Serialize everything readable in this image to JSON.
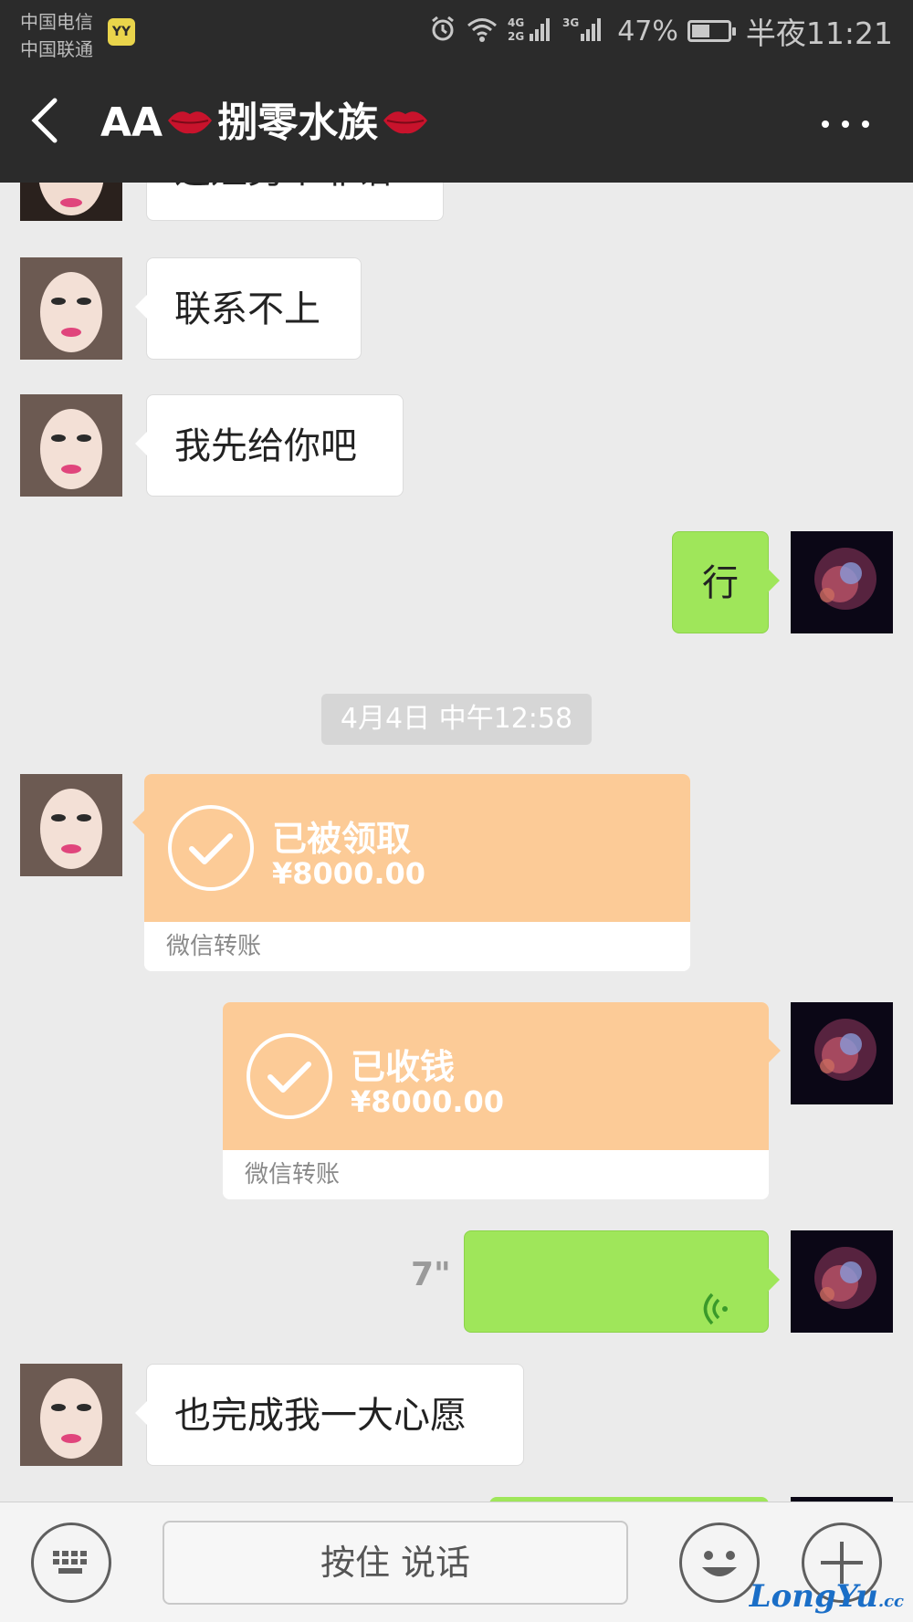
{
  "status_bar": {
    "carrier_1": "中国电信",
    "carrier_2": "中国联通",
    "app_badge": "YY",
    "network_1": "4G",
    "network_1b": "2G",
    "network_2": "3G",
    "battery_percent": "47%",
    "battery_level": 0.47,
    "time": "半夜11:21"
  },
  "header": {
    "title_prefix": "AA",
    "title_main": "捌零水族",
    "back_icon": "chevron-left-icon",
    "more_icon": "ellipsis-icon"
  },
  "messages": [
    {
      "side": "left",
      "type": "text",
      "text": "这娃另个靠谱"
    },
    {
      "side": "left",
      "type": "text",
      "text": "联系不上"
    },
    {
      "side": "left",
      "type": "text",
      "text": "我先给你吧"
    },
    {
      "side": "right",
      "type": "text",
      "text": "行"
    },
    {
      "type": "timestamp",
      "text": "4月4日 中午12:58"
    },
    {
      "side": "left",
      "type": "transfer",
      "status": "已被领取",
      "amount": "¥8000.00",
      "footer": "微信转账"
    },
    {
      "side": "right",
      "type": "transfer",
      "status": "已收钱",
      "amount": "¥8000.00",
      "footer": "微信转账"
    },
    {
      "side": "right",
      "type": "voice",
      "duration": "7\""
    },
    {
      "side": "left",
      "type": "text",
      "text": "也完成我一大心愿"
    }
  ],
  "input_bar": {
    "keyboard_icon": "keyboard-icon",
    "hold_to_talk": "按住 说话",
    "emoji_icon": "emoji-icon",
    "plus_icon": "plus-icon"
  },
  "watermark": {
    "brand": "LongYu",
    "suffix": ".cc"
  },
  "colors": {
    "header_bg": "#2b2b2b",
    "chat_bg": "#ebebeb",
    "self_bubble": "#9fe65a",
    "transfer_bg": "#fccb97"
  }
}
